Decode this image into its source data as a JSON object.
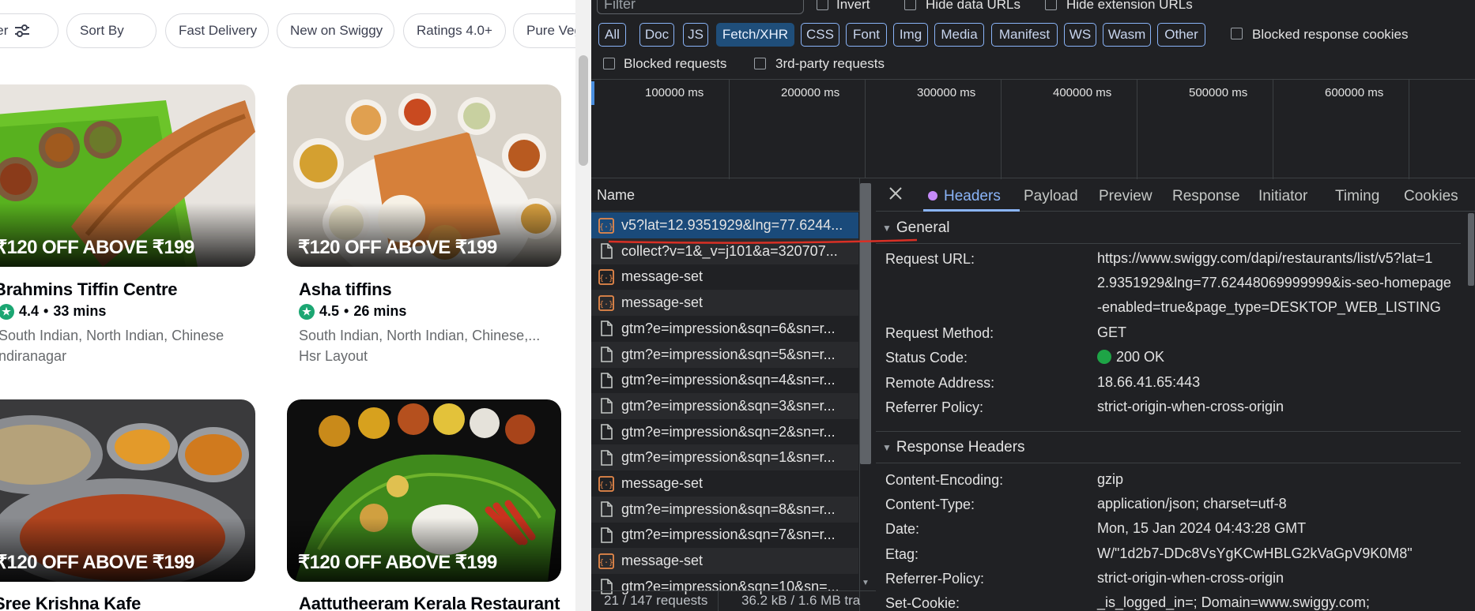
{
  "site": {
    "filter_chips": [
      {
        "label": "ilter"
      },
      {
        "label": "Sort By"
      },
      {
        "label": "Fast Delivery"
      },
      {
        "label": "New on Swiggy"
      },
      {
        "label": "Ratings 4.0+"
      },
      {
        "label": "Pure Veg"
      }
    ],
    "restaurants": [
      {
        "offer": "₹120 OFF ABOVE ₹199",
        "name": "Brahmins Tiffin Centre",
        "rating": "4.4",
        "eta": "33 mins",
        "cuisines": "South Indian, North Indian, Chinese",
        "area": "ndiranagar"
      },
      {
        "offer": "₹120 OFF ABOVE ₹199",
        "name": "Asha tiffins",
        "rating": "4.5",
        "eta": "26 mins",
        "cuisines": "South Indian, North Indian, Chinese,...",
        "area": "Hsr Layout"
      },
      {
        "offer": "₹120 OFF ABOVE ₹199",
        "name": "Sree Krishna Kafe"
      },
      {
        "offer": "₹120 OFF ABOVE ₹199",
        "name": "Aattutheeram Kerala Restaurant"
      }
    ]
  },
  "devtools": {
    "filter_placeholder": "Filter",
    "invert_label": "Invert",
    "hide_data_urls_label": "Hide data URLs",
    "hide_extension_urls_label": "Hide extension URLs",
    "type_filters": [
      "All",
      "Doc",
      "JS",
      "Fetch/XHR",
      "CSS",
      "Font",
      "Img",
      "Media",
      "Manifest",
      "WS",
      "Wasm",
      "Other"
    ],
    "active_type_filter": "Fetch/XHR",
    "blocked_response_cookies_label": "Blocked response cookies",
    "blocked_requests_label": "Blocked requests",
    "third_party_label": "3rd-party requests",
    "timeline_labels": [
      "100000 ms",
      "200000 ms",
      "300000 ms",
      "400000 ms",
      "500000 ms",
      "600000 ms"
    ],
    "name_column": "Name",
    "requests": [
      {
        "name": "v5?lat=12.9351929&lng=77.6244...",
        "icon": "xhr-json-icon",
        "selected": true
      },
      {
        "name": "collect?v=1&_v=j101&a=320707...",
        "icon": "document-icon"
      },
      {
        "name": "message-set",
        "icon": "xhr-json-icon"
      },
      {
        "name": "message-set",
        "icon": "xhr-json-icon"
      },
      {
        "name": "gtm?e=impression&sqn=6&sn=r...",
        "icon": "document-icon"
      },
      {
        "name": "gtm?e=impression&sqn=5&sn=r...",
        "icon": "document-icon"
      },
      {
        "name": "gtm?e=impression&sqn=4&sn=r...",
        "icon": "document-icon"
      },
      {
        "name": "gtm?e=impression&sqn=3&sn=r...",
        "icon": "document-icon"
      },
      {
        "name": "gtm?e=impression&sqn=2&sn=r...",
        "icon": "document-icon"
      },
      {
        "name": "gtm?e=impression&sqn=1&sn=r...",
        "icon": "document-icon"
      },
      {
        "name": "message-set",
        "icon": "xhr-json-icon"
      },
      {
        "name": "gtm?e=impression&sqn=8&sn=r...",
        "icon": "document-icon"
      },
      {
        "name": "gtm?e=impression&sqn=7&sn=r...",
        "icon": "document-icon"
      },
      {
        "name": "message-set",
        "icon": "xhr-json-icon"
      },
      {
        "name": "gtm?e=impression&sqn=10&sn=...",
        "icon": "document-icon"
      }
    ],
    "status": {
      "requests": "21 / 147 requests",
      "transferred": "36.2 kB / 1.6 MB tra"
    },
    "detail_tabs": [
      "Headers",
      "Payload",
      "Preview",
      "Response",
      "Initiator",
      "Timing",
      "Cookies"
    ],
    "active_detail_tab": "Headers",
    "general": {
      "title": "General",
      "rows": [
        {
          "key": "Request URL:",
          "value": [
            "https://www.swiggy.com/dapi/restaurants/list/v5?lat=1",
            "2.9351929&lng=77.62448069999999&is-seo-homepage",
            "-enabled=true&page_type=DESKTOP_WEB_LISTING"
          ]
        },
        {
          "key": "Request Method:",
          "value": [
            "GET"
          ]
        },
        {
          "key": "Status Code:",
          "value": [
            "200 OK"
          ]
        },
        {
          "key": "Remote Address:",
          "value": [
            "18.66.41.65:443"
          ]
        },
        {
          "key": "Referrer Policy:",
          "value": [
            "strict-origin-when-cross-origin"
          ]
        }
      ]
    },
    "response_headers": {
      "title": "Response Headers",
      "rows": [
        {
          "key": "Content-Encoding:",
          "value": "gzip"
        },
        {
          "key": "Content-Type:",
          "value": "application/json; charset=utf-8"
        },
        {
          "key": "Date:",
          "value": "Mon, 15 Jan 2024 04:43:28 GMT"
        },
        {
          "key": "Etag:",
          "value": "W/\"1d2b7-DDc8VsYgKCwHBLG2kVaGpV9K0M8\""
        },
        {
          "key": "Referrer-Policy:",
          "value": "strict-origin-when-cross-origin"
        },
        {
          "key": "Set-Cookie:",
          "value": "_is_logged_in=; Domain=www.swiggy.com;"
        }
      ]
    },
    "colors": {
      "accent": "#8ab4f8",
      "selected_row": "#1a4a7a",
      "annotation_red": "#d93025",
      "status_ok": "#1ea446"
    }
  }
}
